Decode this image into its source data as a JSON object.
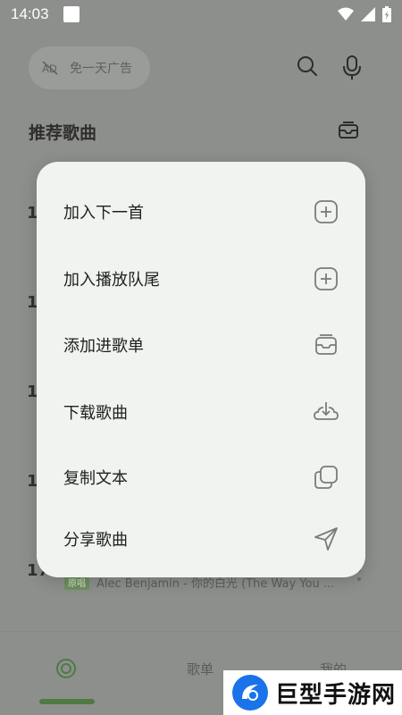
{
  "status_bar": {
    "time": "14:03"
  },
  "search": {
    "placeholder_text": "免一天广告"
  },
  "section": {
    "title": "推荐歌曲"
  },
  "background_list": {
    "ranks": [
      "1",
      "1",
      "1",
      "1",
      "17"
    ],
    "last_song_badge": "原唱",
    "last_song_title": "Alec Benjamin - 你的白光 (The Way You ..."
  },
  "bottom_nav": {
    "items": [
      {
        "label": "",
        "icon": "disc-icon"
      },
      {
        "label": "歌单"
      },
      {
        "label": "我的"
      }
    ]
  },
  "menu": {
    "items": [
      {
        "label": "加入下一首",
        "icon": "plus-square-icon"
      },
      {
        "label": "加入播放队尾",
        "icon": "plus-square-icon"
      },
      {
        "label": "添加进歌单",
        "icon": "inbox-icon"
      },
      {
        "label": "下载歌曲",
        "icon": "cloud-download-icon"
      },
      {
        "label": "复制文本",
        "icon": "copy-icon"
      },
      {
        "label": "分享歌曲",
        "icon": "send-icon"
      }
    ]
  },
  "watermark": {
    "text": "巨型手游网"
  },
  "colors": {
    "accent": "#4f7a44",
    "menu_bg": "#f0f3ef",
    "overlay_bg": "#8d8f8c"
  }
}
